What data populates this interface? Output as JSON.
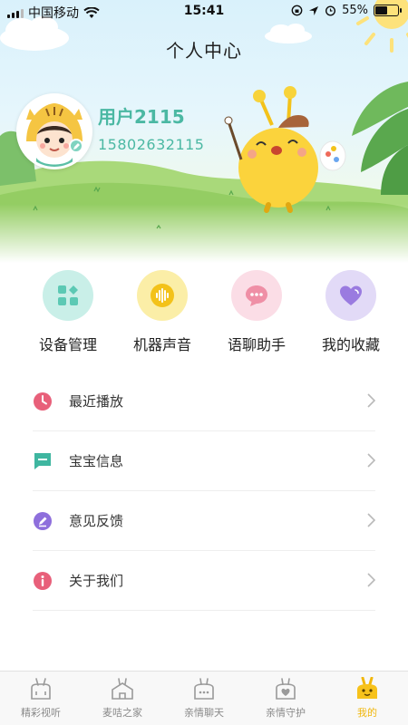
{
  "status_bar": {
    "carrier": "中国移动",
    "time": "15:41",
    "battery_percent": "55%",
    "battery_level": 0.55
  },
  "header": {
    "title": "个人中心"
  },
  "profile": {
    "username": "用户2115",
    "phone": "15802632115"
  },
  "quick_actions": [
    {
      "label": "设备管理",
      "icon": "device-grid-icon",
      "color": "#c9efe8",
      "icon_color": "#5cc9b4"
    },
    {
      "label": "机器声音",
      "icon": "sound-wave-icon",
      "color": "#fbeea7",
      "icon_color": "#f3c21a"
    },
    {
      "label": "语聊助手",
      "icon": "chat-bubble-icon",
      "color": "#fbdde6",
      "icon_color": "#ef8fa6"
    },
    {
      "label": "我的收藏",
      "icon": "heart-icon",
      "color": "#e2daf7",
      "icon_color": "#9a7be0"
    }
  ],
  "menu": [
    {
      "label": "最近播放",
      "icon": "clock-icon",
      "color": "#e8607a"
    },
    {
      "label": "宝宝信息",
      "icon": "message-icon",
      "color": "#3fb6a0"
    },
    {
      "label": "意见反馈",
      "icon": "pen-icon",
      "color": "#8e6fdc"
    },
    {
      "label": "关于我们",
      "icon": "info-icon",
      "color": "#e8607a"
    }
  ],
  "tabs": [
    {
      "label": "精彩视听",
      "active": false
    },
    {
      "label": "麦咭之家",
      "active": false
    },
    {
      "label": "亲情聊天",
      "active": false
    },
    {
      "label": "亲情守护",
      "active": false
    },
    {
      "label": "我的",
      "active": true
    }
  ]
}
